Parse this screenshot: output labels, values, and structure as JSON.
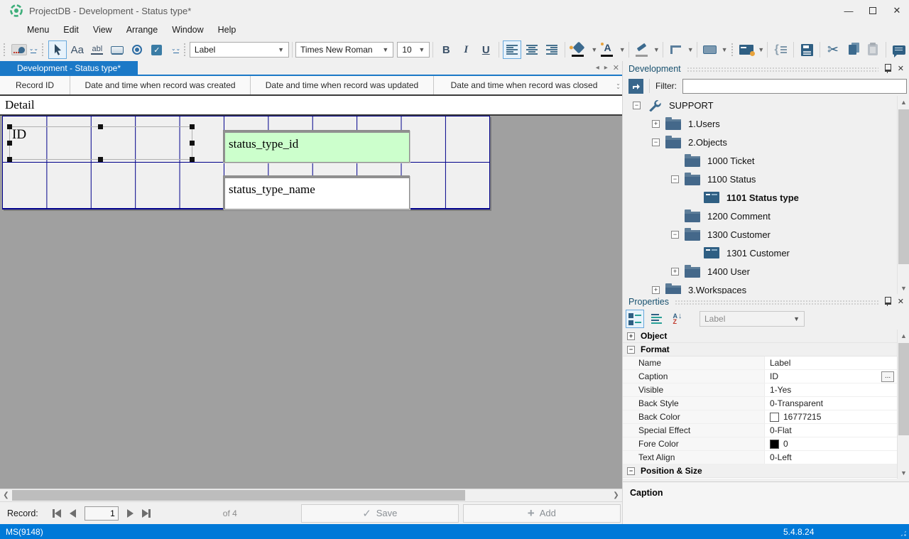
{
  "window": {
    "title": "ProjectDB - Development - Status type*",
    "controls": [
      "minimize",
      "maximize",
      "close"
    ]
  },
  "menu": {
    "items": [
      "Menu",
      "Edit",
      "View",
      "Arrange",
      "Window",
      "Help"
    ]
  },
  "toolbar": {
    "control_combo": "Label",
    "font_combo": "Times New Roman",
    "size_combo": "10",
    "bold_label": "B",
    "italic_label": "I",
    "underline_label": "U",
    "label_tool_text": "Aa",
    "textbox_tool_text": "abl",
    "icon_names": [
      "image-tool-icon",
      "toolbar-overflow-icon",
      "select-pointer-icon",
      "label-tool-icon",
      "textbox-tool-icon",
      "button-tool-icon",
      "radio-tool-icon",
      "checkbox-tool-icon",
      "bold-icon",
      "italic-icon",
      "underline-icon",
      "align-left-icon",
      "align-center-icon",
      "align-right-icon",
      "fill-color-icon",
      "font-color-icon",
      "highlighter-icon",
      "border-corner-icon",
      "shape-icon",
      "form-history-icon",
      "structure-icon",
      "save-icon",
      "cut-icon",
      "copy-icon",
      "paste-icon",
      "comment-icon"
    ]
  },
  "tab": {
    "label": "Development - Status type*"
  },
  "columns": {
    "headers": [
      "Record ID",
      "Date and time when record was created",
      "Date and time when record was updated",
      "Date and time when record was closed"
    ]
  },
  "designer": {
    "section_label": "Detail",
    "selected_label_caption": "ID",
    "field_id_text": "status_type_id",
    "field_name_text": "status_type_name"
  },
  "dev_panel": {
    "title": "Development",
    "filter_label": "Filter:",
    "filter_value": "",
    "tree": [
      {
        "label": "SUPPORT",
        "level": 0,
        "toggle": "-",
        "icon": "wrench",
        "bold": false
      },
      {
        "label": "1.Users",
        "level": 1,
        "toggle": "+",
        "icon": "folder",
        "bold": false
      },
      {
        "label": "2.Objects",
        "level": 1,
        "toggle": "-",
        "icon": "folder",
        "bold": false
      },
      {
        "label": "1000 Ticket",
        "level": 2,
        "toggle": "",
        "icon": "folder",
        "bold": false
      },
      {
        "label": "1100 Status",
        "level": 2,
        "toggle": "-",
        "icon": "folder",
        "bold": false
      },
      {
        "label": "1101 Status type",
        "level": 3,
        "toggle": "",
        "icon": "form",
        "bold": true
      },
      {
        "label": "1200 Comment",
        "level": 2,
        "toggle": "",
        "icon": "folder",
        "bold": false
      },
      {
        "label": "1300 Customer",
        "level": 2,
        "toggle": "-",
        "icon": "folder",
        "bold": false
      },
      {
        "label": "1301 Customer",
        "level": 3,
        "toggle": "",
        "icon": "form",
        "bold": false
      },
      {
        "label": "1400 User",
        "level": 2,
        "toggle": "+",
        "icon": "folder",
        "bold": false
      },
      {
        "label": "3.Workspaces",
        "level": 1,
        "toggle": "+",
        "icon": "folder",
        "bold": false
      }
    ]
  },
  "properties": {
    "title": "Properties",
    "selector_value": "Label",
    "rows": [
      {
        "type": "group",
        "toggle": "+",
        "label": "Object"
      },
      {
        "type": "group",
        "toggle": "-",
        "label": "Format"
      },
      {
        "type": "prop",
        "label": "Name",
        "value": "Label"
      },
      {
        "type": "prop",
        "label": "Caption",
        "value": "ID",
        "ellipsis": true
      },
      {
        "type": "prop",
        "label": "Visible",
        "value": "1-Yes"
      },
      {
        "type": "prop",
        "label": "Back Style",
        "value": "0-Transparent"
      },
      {
        "type": "prop",
        "label": "Back Color",
        "value": "16777215",
        "swatch": "#ffffff"
      },
      {
        "type": "prop",
        "label": "Special Effect",
        "value": "0-Flat"
      },
      {
        "type": "prop",
        "label": "Fore Color",
        "value": "0",
        "swatch": "#000000"
      },
      {
        "type": "prop",
        "label": "Text Align",
        "value": "0-Left"
      },
      {
        "type": "group",
        "toggle": "-",
        "label": "Position & Size"
      }
    ],
    "description": "Caption"
  },
  "record_bar": {
    "label": "Record:",
    "current": "1",
    "of_text": "of 4",
    "save_label": "Save",
    "add_label": "Add"
  },
  "status_bar": {
    "left": "MS(9148)",
    "version": "5.4.8.24"
  },
  "colors": {
    "accent_blue": "#1b79c7",
    "statusbar_blue": "#0079d8",
    "grid_line_navy": "#00008b",
    "field_green": "#ccffcc",
    "canvas_gray": "#a0a0a0",
    "icon_steel": "#3c6a8e"
  }
}
